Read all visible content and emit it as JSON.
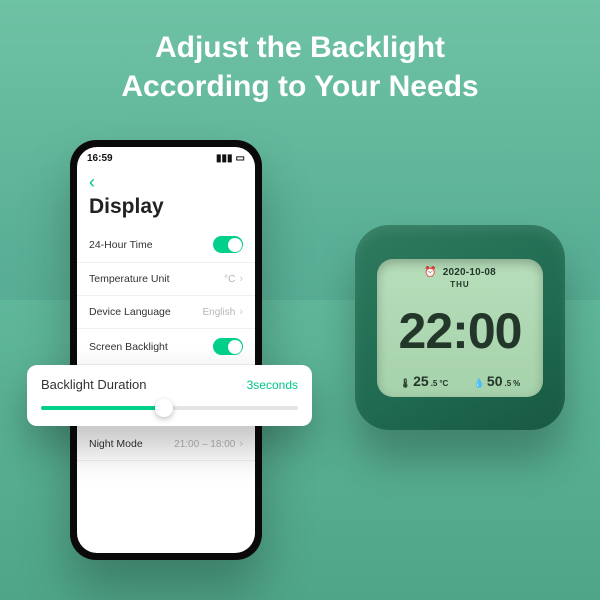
{
  "title_line1": "Adjust the Backlight",
  "title_line2": "According to Your Needs",
  "phone": {
    "status_time": "16:59",
    "back": "‹",
    "heading": "Display",
    "rows": {
      "time24": "24-Hour Time",
      "temp_unit_label": "Temperature Unit",
      "temp_unit_value": "°C",
      "device_lang_label": "Device Language",
      "device_lang_value": "English",
      "screen_backlight": "Screen Backlight",
      "night_mode_label": "Night Mode",
      "night_mode_value": "21:00 – 18:00"
    }
  },
  "popout": {
    "label": "Backlight Duration",
    "value": "3seconds"
  },
  "clock": {
    "date": "2020-10-08",
    "day": "THU",
    "time": "22:00",
    "temp": "25",
    "temp_dec": ".5",
    "temp_unit": "°C",
    "hum": "50",
    "hum_dec": ".5",
    "hum_unit": "%"
  }
}
